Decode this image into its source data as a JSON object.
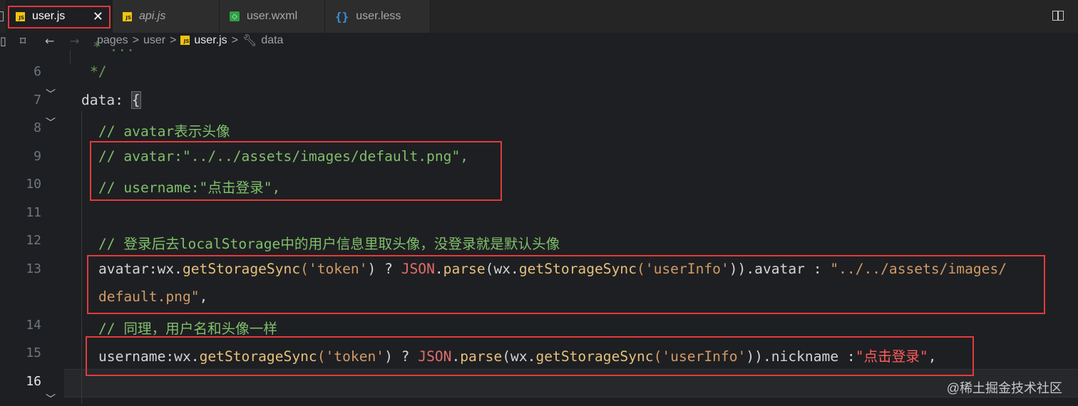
{
  "tabs": [
    {
      "label": "user.js",
      "icon": "js-icon",
      "active": true
    },
    {
      "label": "api.js",
      "icon": "js-icon",
      "active": false
    },
    {
      "label": "user.wxml",
      "icon": "wxml-icon",
      "active": false
    },
    {
      "label": "user.less",
      "icon": "braces-icon",
      "active": false
    }
  ],
  "breadcrumb": {
    "items": [
      "pages",
      "user",
      "user.js",
      "data"
    ],
    "separator": ">"
  },
  "lines": [
    {
      "num": "6"
    },
    {
      "num": "7"
    },
    {
      "num": "8"
    },
    {
      "num": "9"
    },
    {
      "num": "10"
    },
    {
      "num": "11"
    },
    {
      "num": "12"
    },
    {
      "num": "13"
    },
    {
      "num": "14"
    },
    {
      "num": "15"
    },
    {
      "num": "16"
    }
  ],
  "code": {
    "l5_partial": "* ...",
    "l6": "*/",
    "l7_key": "data",
    "l7_colon": ": ",
    "l7_brace": "{",
    "l8": "// avatar表示头像",
    "l9": "// avatar:\"../../assets/images/default.png\",",
    "l10": "// username:\"点击登录\",",
    "l12": "// 登录后去localStorage中的用户信息里取头像，没登录就是默认头像",
    "l13_a": "avatar",
    "l13_b": ":wx.",
    "l13_fn1": "getStorageSync",
    "l13_p1": "(",
    "l13_s1": "'token'",
    "l13_p2": ") ? ",
    "l13_json": "JSON",
    "l13_dot": ".",
    "l13_parse": "parse",
    "l13_p3": "(wx.",
    "l13_fn2": "getStorageSync",
    "l13_p4": "(",
    "l13_s2": "'userInfo'",
    "l13_p5": ")).avatar : ",
    "l13_s3": "\"../../assets/images/",
    "l13w_s": "default.png\"",
    "l13w_c": ",",
    "l14": "// 同理，用户名和头像一样",
    "l15_a": "username",
    "l15_b": ":wx.",
    "l15_fn1": "getStorageSync",
    "l15_p1": "(",
    "l15_s1": "'token'",
    "l15_p2": ") ? ",
    "l15_json": "JSON",
    "l15_dot": ".",
    "l15_parse": "parse",
    "l15_p3": "(wx.",
    "l15_fn2": "getStorageSync",
    "l15_p4": "(",
    "l15_s2": "'userInfo'",
    "l15_p5": ")).nickname :",
    "l15_s3q": "\"",
    "l15_cn": "点击登录",
    "l15_s3e": "\"",
    "l15_c": ","
  },
  "watermark": "@稀土掘金技术社区",
  "colors": {
    "highlight": "#e23b3b",
    "comment": "#6a9955",
    "function": "#e5c07b",
    "string": "#d19a66"
  }
}
